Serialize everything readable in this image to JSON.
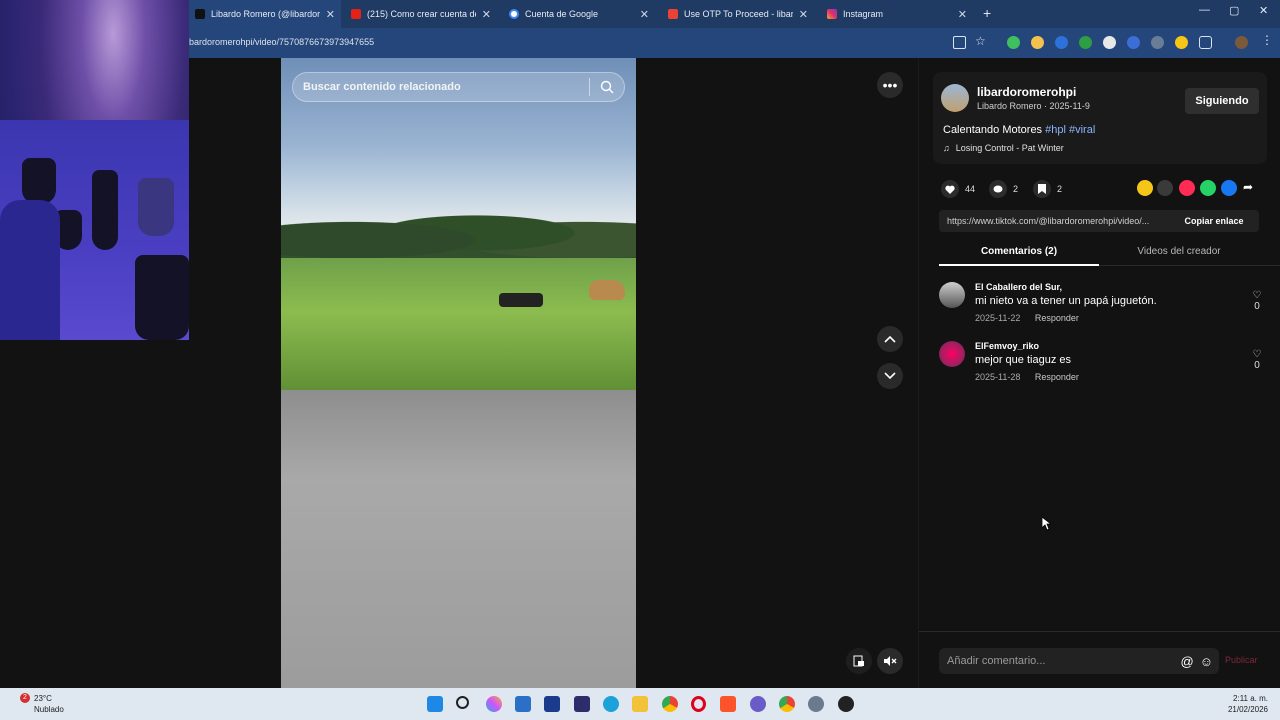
{
  "browser": {
    "tabs": [
      {
        "title": "Libardo Romero (@libardorome",
        "active": true
      },
      {
        "title": "(215) Como crear cuenta de Ki",
        "active": false
      },
      {
        "title": "Cuenta de Google",
        "active": false
      },
      {
        "title": "Use OTP To Proceed - libardoro",
        "active": false
      },
      {
        "title": "Instagram",
        "active": false
      }
    ],
    "url": "bardoromerohpi/video/7570876673973947655"
  },
  "video": {
    "search_placeholder": "Buscar contenido relacionado"
  },
  "author": {
    "username": "libardoromerohpi",
    "meta": "Libardo Romero · 2025-11-9",
    "follow_label": "Siguiendo",
    "caption": "Calentando Motores",
    "hashtags": "#hpl #viral",
    "music": "Losing Control - Pat Winter"
  },
  "stats": {
    "likes": "44",
    "comments": "2",
    "saves": "2"
  },
  "link": {
    "url": "https://www.tiktok.com/@libardoromerohpi/video/...",
    "copy_label": "Copiar enlace"
  },
  "tabs": {
    "comments": "Comentarios (2)",
    "creator_videos": "Videos del creador"
  },
  "comments": [
    {
      "user": "El Caballero del Sur,",
      "text": "mi nieto va a tener un papá juguetón.",
      "date": "2025-11-22",
      "reply": "Responder",
      "likes": "0"
    },
    {
      "user": "ElFemvoy_riko",
      "text": "mejor que tiaguz es",
      "date": "2025-11-28",
      "reply": "Responder",
      "likes": "0"
    }
  ],
  "composer": {
    "placeholder": "Añadir comentario...",
    "publish": "Publicar"
  },
  "taskbar": {
    "weather_temp": "23°C",
    "weather_desc": "Nublado",
    "weather_badge": "2",
    "time": "2:11 a. m.",
    "date": "21/02/2026"
  }
}
